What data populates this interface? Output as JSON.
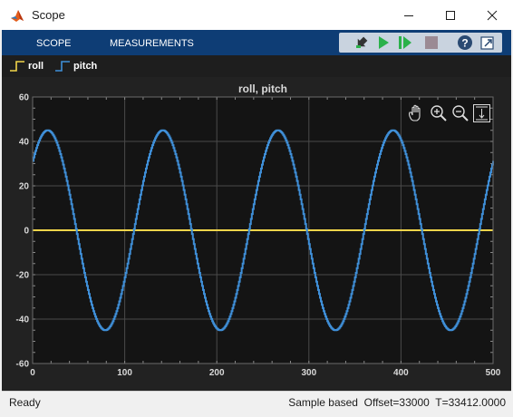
{
  "window": {
    "title": "Scope"
  },
  "toolstrip": {
    "tabs": [
      "SCOPE",
      "MEASUREMENTS"
    ],
    "quick_access": [
      "step-back-icon",
      "run-icon",
      "step-forward-icon",
      "stop-icon",
      "help-icon",
      "undock-icon"
    ]
  },
  "legend": {
    "items": [
      {
        "label": "roll",
        "color": "#f2d54a"
      },
      {
        "label": "pitch",
        "color": "#3f8fd8"
      }
    ]
  },
  "plot_toolbar": [
    "pan-icon",
    "zoom-in-icon",
    "zoom-out-icon",
    "autoscale-icon"
  ],
  "colors": {
    "toolstrip": "#0e3d75",
    "plot_bg": "#141414",
    "frame_bg": "#222222"
  },
  "chart_data": {
    "type": "line",
    "title": "roll, pitch",
    "xlabel": "",
    "ylabel": "",
    "xlim": [
      0,
      500
    ],
    "ylim": [
      -60,
      60
    ],
    "x_ticks": [
      0,
      100,
      200,
      300,
      400,
      500
    ],
    "y_ticks": [
      -60,
      -40,
      -20,
      0,
      20,
      40,
      60
    ],
    "grid": true,
    "series": [
      {
        "name": "roll",
        "color": "#f2d54a",
        "constant": 0
      },
      {
        "name": "pitch",
        "color": "#3f8fd8",
        "amplitude": 45,
        "period": 125,
        "first_peak_x": 16,
        "x_start": 0,
        "x_end": 500
      }
    ]
  },
  "status": {
    "left": "Ready",
    "right": "Sample based  Offset=33000  T=33412.0000"
  }
}
